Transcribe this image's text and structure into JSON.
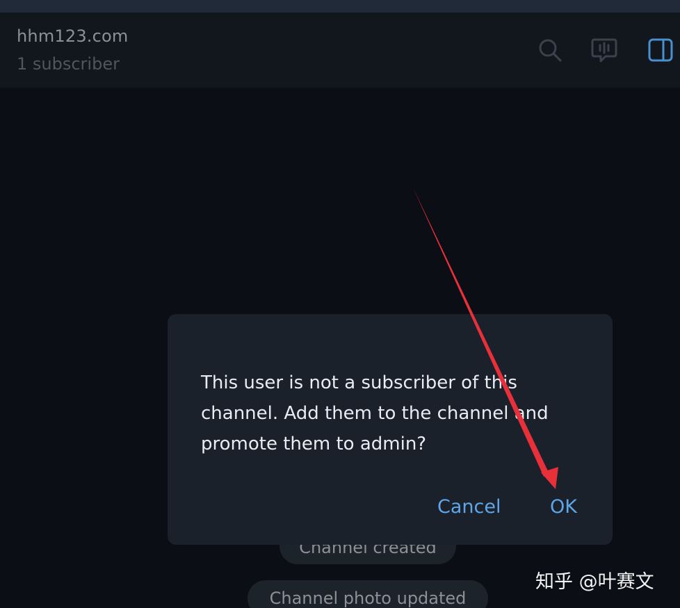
{
  "header": {
    "title": "hhm123.com",
    "subtitle": "1 subscriber",
    "icons": [
      "search-icon",
      "voice-chat-icon",
      "side-panel-icon"
    ]
  },
  "service_messages": [
    "Channel created",
    "Channel photo updated"
  ],
  "dialog": {
    "message": "This user is not a subscriber of this channel. Add them to the channel and promote them to admin?",
    "cancel_label": "Cancel",
    "ok_label": "OK"
  },
  "watermark": "知乎 @叶赛文",
  "colors": {
    "background": "#0b0e14",
    "header": "#12161d",
    "dialog": "#1a212b",
    "accent": "#5ea6e8",
    "annotation_arrow": "#e8303a"
  }
}
